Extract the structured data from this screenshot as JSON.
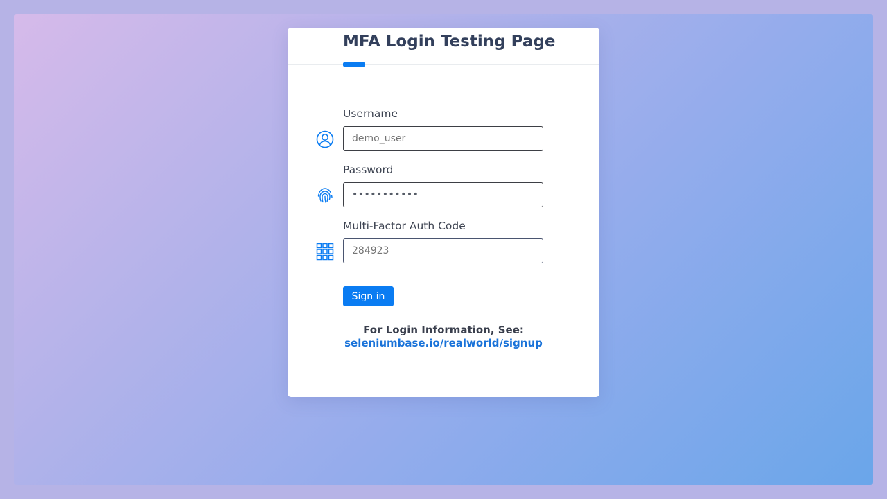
{
  "page": {
    "title": "MFA Login Testing Page"
  },
  "form": {
    "username": {
      "label": "Username",
      "value": "",
      "placeholder": "demo_user",
      "icon": "user-circle-icon"
    },
    "password": {
      "label": "Password",
      "value": "secret_pass",
      "icon": "fingerprint-icon"
    },
    "mfa": {
      "label": "Multi-Factor Auth Code",
      "value": "",
      "placeholder": "284923",
      "icon": "keypad-grid-icon"
    },
    "submit_label": "Sign in"
  },
  "info": {
    "heading": "For Login Information, See:",
    "link_text": "seleniumbase.io/realworld/signup"
  },
  "colors": {
    "accent": "#0a7cf2",
    "title_text": "#33405c",
    "link": "#1a73d9",
    "card_bg": "#ffffff"
  }
}
